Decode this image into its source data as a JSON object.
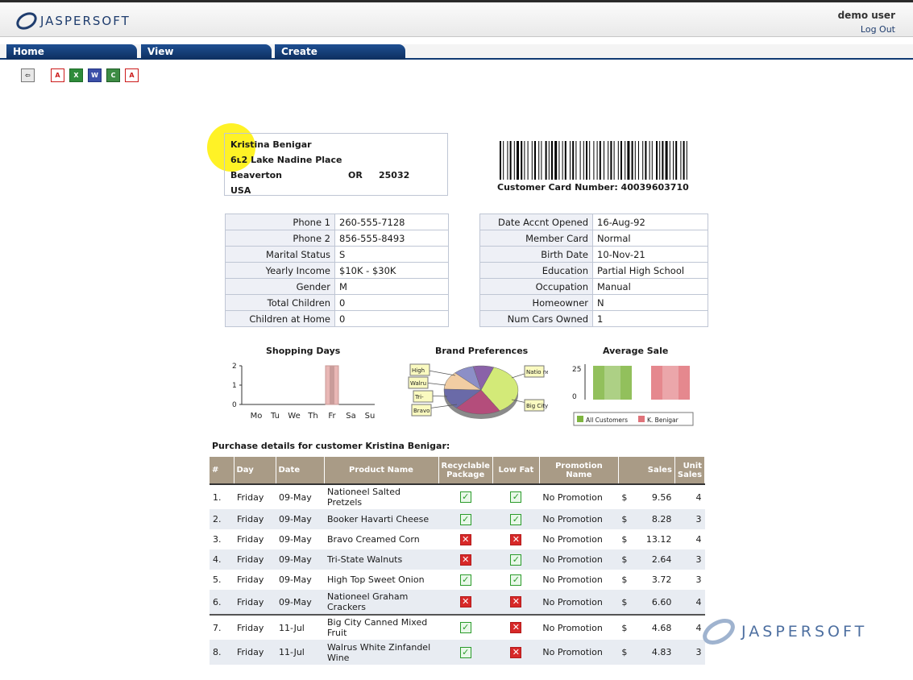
{
  "header": {
    "logo_text": "JASPERSOFT",
    "user": "demo user",
    "logout": "Log Out"
  },
  "menu": [
    "Home",
    "View",
    "Create"
  ],
  "toolbar_icons": [
    "back-icon",
    "pdf-icon",
    "excel-icon",
    "word-icon",
    "csv-icon",
    "pdf-export-icon"
  ],
  "customer": {
    "name": "Kristina Benigar",
    "street": "6ʟ2 Lake Nadine Place",
    "city": "Beaverton",
    "state": "OR",
    "zip": "25032",
    "country": "USA",
    "barcode_label": "Customer Card Number: 40039603710"
  },
  "details_left": [
    {
      "label": "Phone 1",
      "value": "260-555-7128"
    },
    {
      "label": "Phone 2",
      "value": "856-555-8493"
    },
    {
      "label": "Marital Status",
      "value": "S"
    },
    {
      "label": "Yearly Income",
      "value": "$10K - $30K"
    },
    {
      "label": "Gender",
      "value": "M"
    },
    {
      "label": "Total Children",
      "value": "0"
    },
    {
      "label": "Children at Home",
      "value": "0"
    }
  ],
  "details_right": [
    {
      "label": "Date Accnt Opened",
      "value": "16-Aug-92"
    },
    {
      "label": "Member Card",
      "value": "Normal"
    },
    {
      "label": "Birth Date",
      "value": "10-Nov-21"
    },
    {
      "label": "Education",
      "value": "Partial High School"
    },
    {
      "label": "Occupation",
      "value": "Manual"
    },
    {
      "label": "Homeowner",
      "value": "N"
    },
    {
      "label": "Num Cars Owned",
      "value": "1"
    }
  ],
  "chart_data": [
    {
      "type": "bar",
      "title": "Shopping Days",
      "categories": [
        "Mo",
        "Tu",
        "We",
        "Th",
        "Fr",
        "Sa",
        "Su"
      ],
      "values": [
        0,
        0,
        0,
        0,
        2,
        0,
        0
      ],
      "yticks": [
        "0",
        "1",
        "2"
      ],
      "ylim": [
        0,
        2
      ]
    },
    {
      "type": "pie",
      "title": "Brand Preferences",
      "labels": [
        "Nationeel",
        "Big City",
        "Bravo",
        "Tri-State",
        "Walrus",
        "High Top"
      ],
      "values": [
        36,
        20,
        14,
        12,
        9,
        9
      ],
      "colors": [
        "#d3ea78",
        "#b44d7b",
        "#6a6aa8",
        "#f1cda3",
        "#8c8fc7",
        "#8a62a8"
      ]
    },
    {
      "type": "bar",
      "title": "Average Sale",
      "categories": [
        "All Customers",
        "K. Benigar"
      ],
      "series": [
        {
          "name": "All Customers",
          "values": [
            29
          ]
        },
        {
          "name": "K. Benigar",
          "values": [
            29
          ]
        }
      ],
      "yticks": [
        "0",
        "25"
      ],
      "colors": [
        "#7fb540",
        "#e0737a"
      ]
    }
  ],
  "purchases": {
    "title": "Purchase details for customer Kristina Benigar:",
    "headers": [
      "#",
      "Day",
      "Date",
      "Product Name",
      "Recyclable Package",
      "Low Fat",
      "Promotion Name",
      "Sales",
      "Unit Sales"
    ],
    "rows": [
      {
        "num": "1.",
        "day": "Friday",
        "date": "09-May",
        "product": "Nationeel Salted Pretzels",
        "recyclable": true,
        "lowfat": true,
        "promotion": "No Promotion",
        "cur": "$",
        "sales": "9.56",
        "units": "4"
      },
      {
        "num": "2.",
        "day": "Friday",
        "date": "09-May",
        "product": "Booker Havarti Cheese",
        "recyclable": true,
        "lowfat": true,
        "promotion": "No Promotion",
        "cur": "$",
        "sales": "8.28",
        "units": "3"
      },
      {
        "num": "3.",
        "day": "Friday",
        "date": "09-May",
        "product": "Bravo Creamed Corn",
        "recyclable": false,
        "lowfat": false,
        "promotion": "No Promotion",
        "cur": "$",
        "sales": "13.12",
        "units": "4"
      },
      {
        "num": "4.",
        "day": "Friday",
        "date": "09-May",
        "product": "Tri-State Walnuts",
        "recyclable": false,
        "lowfat": true,
        "promotion": "No Promotion",
        "cur": "$",
        "sales": "2.64",
        "units": "3"
      },
      {
        "num": "5.",
        "day": "Friday",
        "date": "09-May",
        "product": "High Top Sweet Onion",
        "recyclable": true,
        "lowfat": true,
        "promotion": "No Promotion",
        "cur": "$",
        "sales": "3.72",
        "units": "3"
      },
      {
        "num": "6.",
        "day": "Friday",
        "date": "09-May",
        "product": "Nationeel Graham Crackers",
        "recyclable": false,
        "lowfat": false,
        "promotion": "No Promotion",
        "cur": "$",
        "sales": "6.60",
        "units": "4"
      },
      {
        "num": "7.",
        "day": "Friday",
        "date": "11-Jul",
        "product": "Big City Canned Mixed Fruit",
        "recyclable": true,
        "lowfat": false,
        "promotion": "No Promotion",
        "cur": "$",
        "sales": "4.68",
        "units": "4"
      },
      {
        "num": "8.",
        "day": "Friday",
        "date": "11-Jul",
        "product": "Walrus White Zinfandel Wine",
        "recyclable": true,
        "lowfat": false,
        "promotion": "No Promotion",
        "cur": "$",
        "sales": "4.83",
        "units": "3"
      }
    ]
  },
  "watermark": "JASPERSOFT"
}
